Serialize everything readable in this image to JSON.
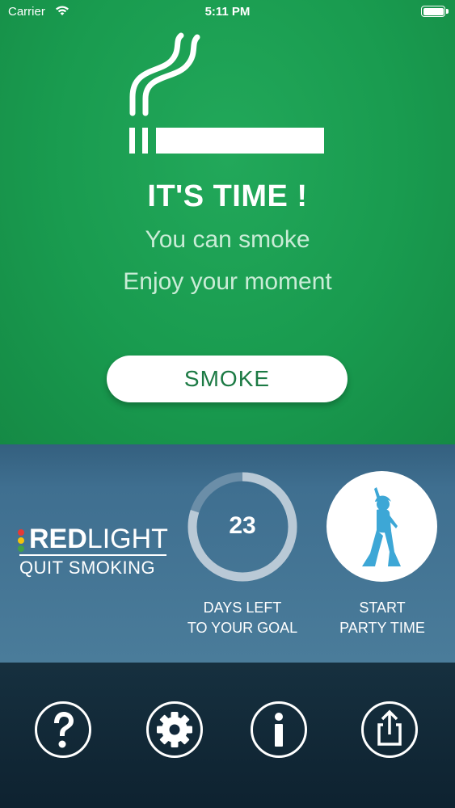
{
  "status_bar": {
    "carrier": "Carrier",
    "time": "5:11 PM",
    "wifi_icon": "wifi-icon",
    "battery_icon": "battery-icon"
  },
  "main": {
    "icon": "cigarette-icon",
    "headline": "IT'S TIME !",
    "subline_1": "You can smoke",
    "subline_2": "Enjoy your moment",
    "smoke_button": "SMOKE"
  },
  "stats": {
    "logo_red": "RED",
    "logo_light": "LIGHT",
    "logo_sub": "QUIT SMOKING",
    "days_left": "23",
    "days_progress_fraction": 0.8,
    "days_label_1": "DAYS LEFT",
    "days_label_2": "TO YOUR GOAL",
    "party_icon": "dancer-icon",
    "party_label_1": "START",
    "party_label_2": "PARTY TIME"
  },
  "nav": {
    "help_icon": "question-icon",
    "settings_icon": "gear-icon",
    "info_icon": "info-icon",
    "share_icon": "share-icon"
  },
  "colors": {
    "green": "#199b4f",
    "blue": "#3f6f90",
    "dark": "#0e2230",
    "accent_blue": "#3da7d6",
    "light_red": "#e53935",
    "light_yellow": "#f4c20d",
    "light_green": "#43a047"
  }
}
